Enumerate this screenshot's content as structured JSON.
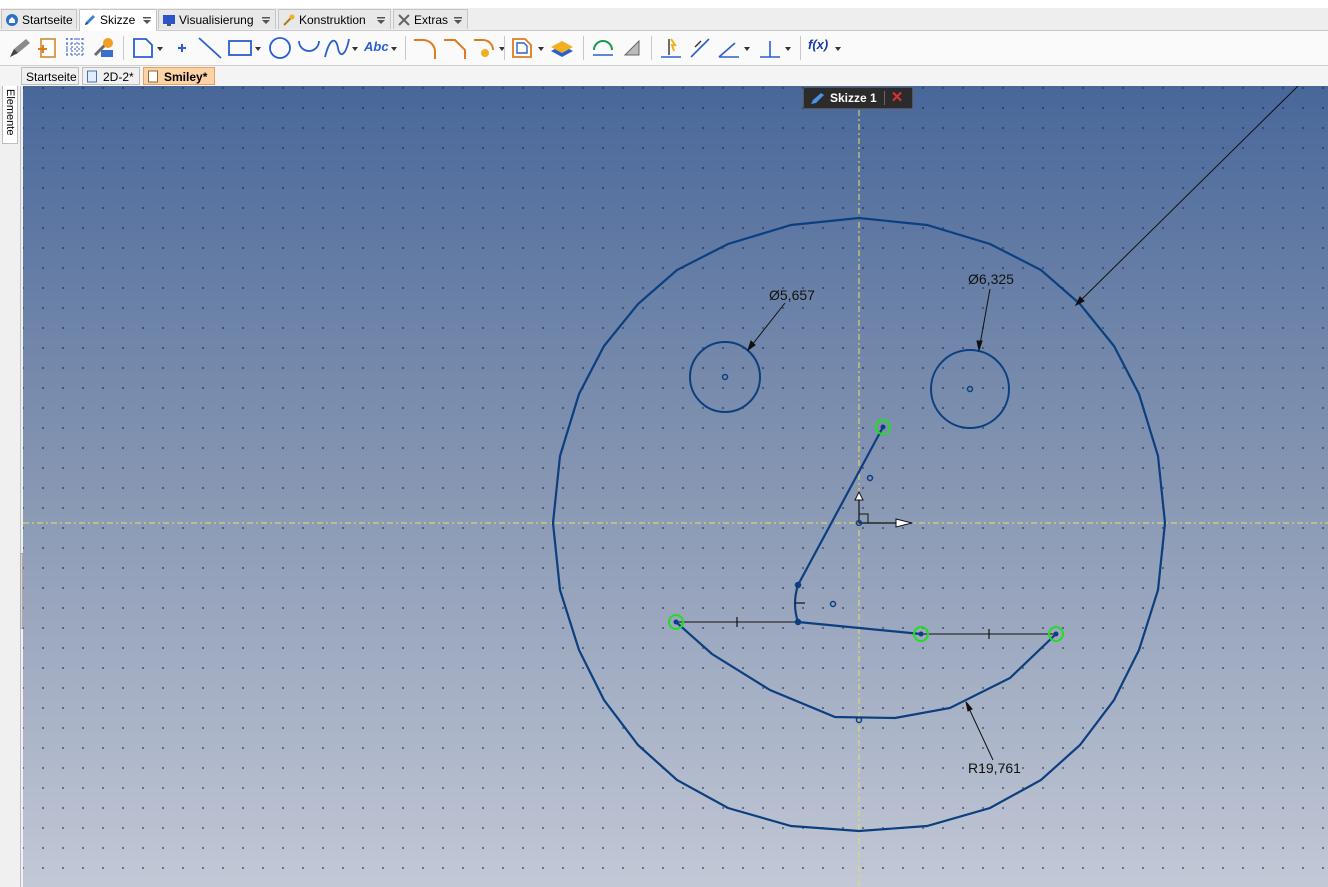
{
  "ribbon": {
    "tabs": [
      {
        "label": "Startseite",
        "icon": "home-icon"
      },
      {
        "label": "Skizze",
        "icon": "pencil-icon"
      },
      {
        "label": "Visualisierung",
        "icon": "monitor-icon"
      },
      {
        "label": "Konstruktion",
        "icon": "wand-icon"
      },
      {
        "label": "Extras",
        "icon": "tools-icon"
      }
    ],
    "active_tab": "Skizze"
  },
  "toolbar": {
    "text_tool_label": "Abc",
    "formula_tool_label": "f(x)"
  },
  "doc_tabs": [
    {
      "label": "Startseite"
    },
    {
      "label": "2D-2*"
    },
    {
      "label": "Smiley*"
    }
  ],
  "active_doc": "Smiley*",
  "side_panel": {
    "label": "Elemente"
  },
  "sketch": {
    "label": "Skizze 1",
    "close_symbol": "✕",
    "dimensions": {
      "left_eye": "Ø5,657",
      "right_eye": "Ø6,325",
      "mouth_radius": "R19,761"
    }
  },
  "colors": {
    "geometry": "#0c3f7f",
    "selected_point": "#22dd22",
    "axis": "#e7e05a",
    "canvas_top": "#48679a",
    "canvas_bottom": "#c2c8d6",
    "active_doc_tab": "#fdd3a6"
  }
}
